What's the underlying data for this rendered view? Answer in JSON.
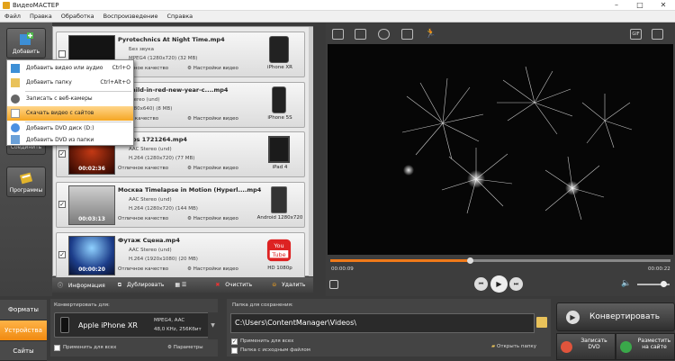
{
  "window": {
    "title": "ВидеоМАСТЕР"
  },
  "menu": [
    "Файл",
    "Правка",
    "Обработка",
    "Воспроизведение",
    "Справка"
  ],
  "left": {
    "add_label": "Добавить",
    "join_label": "Соединить",
    "programs_label": "Программы"
  },
  "dropdown": [
    {
      "label": "Добавить видео или аудио",
      "shortcut": "Ctrl+O",
      "icon": "film-add-icon"
    },
    {
      "label": "Добавить папку",
      "shortcut": "Ctrl+Alt+O",
      "icon": "folder-icon"
    },
    {
      "label": "Записать с веб-камеры",
      "shortcut": "",
      "icon": "webcam-icon"
    },
    {
      "label": "Скачать видео с сайтов",
      "shortcut": "",
      "icon": "download-icon"
    },
    {
      "label": "Добавить DVD диск (D:)",
      "shortcut": "",
      "icon": "dvd-icon"
    },
    {
      "label": "Добавить DVD из папки",
      "shortcut": "",
      "icon": "dvd-folder-icon"
    }
  ],
  "files": [
    {
      "name": "Pyrotechnics At Night Time.mp4",
      "audio": "Без звука",
      "video": "MPEG4 (1280x720) (32 MB)",
      "duration": "",
      "quality": "Отличное качество",
      "settings": "Настройки видео",
      "device": "iPhone XR"
    },
    {
      "name": "child-in-red-new-year-c....mp4",
      "name_prefix": "ой",
      "audio": "Stereo (und)",
      "video": "(480x640) (8 MB)",
      "duration": "",
      "quality": "ичное качество",
      "settings": "Настройки видео",
      "device": "iPhone 5S"
    },
    {
      "name": "Videos 1721264.mp4",
      "audio": "AAC Stereo (und)",
      "video": "H.264 (1280x720) (77 MB)",
      "duration": "00:02:36",
      "quality": "Отличное качество",
      "settings": "Настройки видео",
      "device": "iPad 4"
    },
    {
      "name": "Москва Timelapse in Motion (Hyperl....mp4",
      "audio": "AAC Stereo (und)",
      "video": "H.264 (1280x720) (144 MB)",
      "duration": "00:03:13",
      "quality": "Отличное качество",
      "settings": "Настройки видео",
      "device": "Android 1280x720"
    },
    {
      "name": "Футаж Сцена.mp4",
      "audio": "AAC Stereo (und)",
      "video": "H.264 (1920x1080) (20 MB)",
      "duration": "00:00:20",
      "quality": "Отличное качество",
      "settings": "Настройки видео",
      "device": "HD 1080p"
    }
  ],
  "listbar": {
    "info": "Информация",
    "dup": "Дублировать",
    "clear": "Очистить",
    "delete": "Удалить"
  },
  "player": {
    "time_current": "00:00:09",
    "time_total": "00:00:22",
    "progress": 0.41,
    "volume": 0.8
  },
  "tabs": [
    "Форматы",
    "Устройства",
    "Сайты"
  ],
  "convert": {
    "header": "Конвертировать для:",
    "device": "Apple iPhone XR",
    "spec1": "MPEG4, AAC",
    "spec2": "48,0 KHz, 256Кбит",
    "apply_all": "Применить для всех",
    "params": "Параметры"
  },
  "save": {
    "header": "Папка для сохранения:",
    "path": "C:\\Users\\ContentManager\\Videos\\",
    "apply_all": "Применить для всех",
    "with_source": "Папка с исходным файлом",
    "open": "Открыть папку"
  },
  "actions": {
    "convert": "Конвертировать",
    "dvd": "Записать DVD",
    "web": "Разместить на сайте"
  }
}
